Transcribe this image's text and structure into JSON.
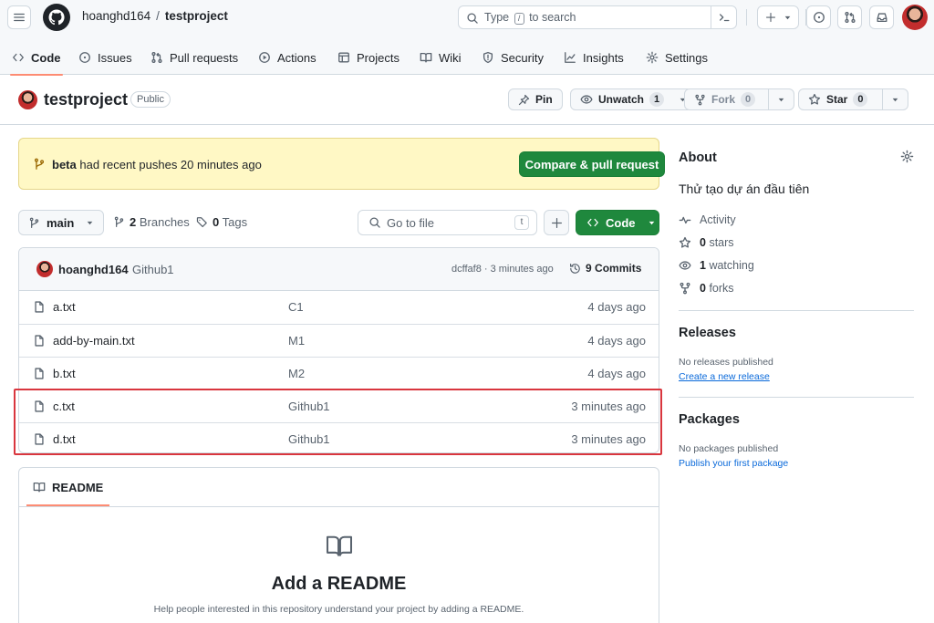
{
  "header": {
    "owner": "hoanghd164",
    "separator": "/",
    "repo": "testproject",
    "search_pre": "Type",
    "search_key": "/",
    "search_post": "to search"
  },
  "tabs": [
    {
      "label": "Code",
      "icon": "code-icon",
      "active": true
    },
    {
      "label": "Issues",
      "icon": "issue-icon"
    },
    {
      "label": "Pull requests",
      "icon": "pull-request-icon"
    },
    {
      "label": "Actions",
      "icon": "play-icon"
    },
    {
      "label": "Projects",
      "icon": "table-icon"
    },
    {
      "label": "Wiki",
      "icon": "book-icon"
    },
    {
      "label": "Security",
      "icon": "shield-icon"
    },
    {
      "label": "Insights",
      "icon": "graph-icon"
    },
    {
      "label": "Settings",
      "icon": "gear-icon"
    }
  ],
  "repo": {
    "name": "testproject",
    "visibility": "Public",
    "pin": "Pin",
    "unwatch": "Unwatch",
    "watch_count": "1",
    "fork": "Fork",
    "fork_count": "0",
    "star": "Star",
    "star_count": "0"
  },
  "flash": {
    "branch": "beta",
    "message": "had recent pushes 20 minutes ago",
    "button": "Compare & pull request"
  },
  "branchbar": {
    "branch": "main",
    "branches_count": "2",
    "branches_label": "Branches",
    "tags_count": "0",
    "tags_label": "Tags",
    "goto_placeholder": "Go to file",
    "goto_key": "t",
    "code_button": "Code"
  },
  "commit": {
    "author": "hoanghd164",
    "message": "Github1",
    "meta": "dcffaf8 · 3 minutes ago",
    "count": "9",
    "count_label": "Commits"
  },
  "files": [
    {
      "name": "a.txt",
      "message": "C1",
      "age": "4 days ago"
    },
    {
      "name": "add-by-main.txt",
      "message": "M1",
      "age": "4 days ago"
    },
    {
      "name": "b.txt",
      "message": "M2",
      "age": "4 days ago"
    },
    {
      "name": "c.txt",
      "message": "Github1",
      "age": "3 minutes ago"
    },
    {
      "name": "d.txt",
      "message": "Github1",
      "age": "3 minutes ago"
    }
  ],
  "readme": {
    "tab": "README",
    "heading": "Add a README",
    "text": "Help people interested in this repository understand your project by adding a README."
  },
  "about": {
    "title": "About",
    "description": "Thử tạo dự án đầu tiên",
    "activity": "Activity",
    "stars_count": "0",
    "stars_label": "stars",
    "watching_count": "1",
    "watching_label": "watching",
    "forks_count": "0",
    "forks_label": "forks"
  },
  "releases": {
    "title": "Releases",
    "empty": "No releases published",
    "link": "Create a new release"
  },
  "packages": {
    "title": "Packages",
    "empty": "No packages published",
    "link": "Publish your first package"
  },
  "colors": {
    "primary_green": "#1f883d",
    "flash_bg": "#fff8c5",
    "tab_underline": "#fd8c73",
    "link_blue": "#0969da",
    "highlight_red": "#d9363e"
  }
}
